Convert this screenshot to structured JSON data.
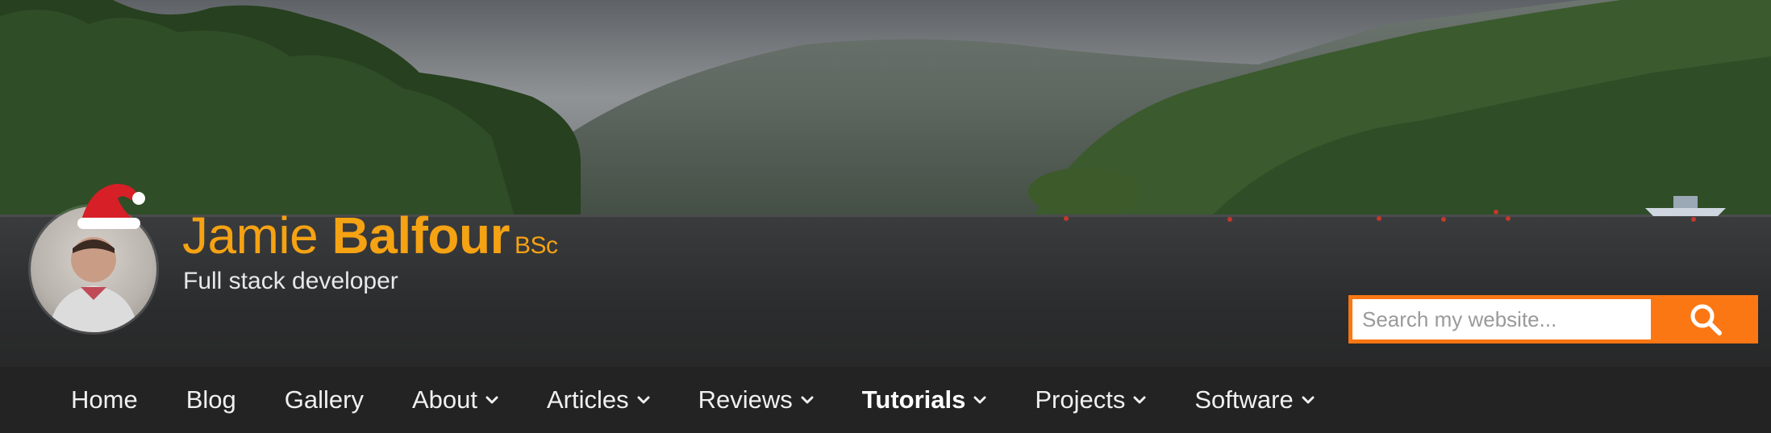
{
  "header": {
    "first_name": "Jamie",
    "last_name": "Balfour",
    "degree": "BSc",
    "role": "Full stack developer"
  },
  "search": {
    "placeholder": "Search my website...",
    "button_icon": "search-icon"
  },
  "nav": {
    "items": [
      {
        "label": "Home",
        "dropdown": false
      },
      {
        "label": "Blog",
        "dropdown": false
      },
      {
        "label": "Gallery",
        "dropdown": false
      },
      {
        "label": "About",
        "dropdown": true
      },
      {
        "label": "Articles",
        "dropdown": true
      },
      {
        "label": "Reviews",
        "dropdown": true
      },
      {
        "label": "Tutorials",
        "dropdown": true,
        "active": true
      },
      {
        "label": "Projects",
        "dropdown": true
      },
      {
        "label": "Software",
        "dropdown": true
      }
    ]
  },
  "colors": {
    "accent": "#f5a213",
    "search_button": "#fb7713",
    "nav_background": "#232323"
  }
}
